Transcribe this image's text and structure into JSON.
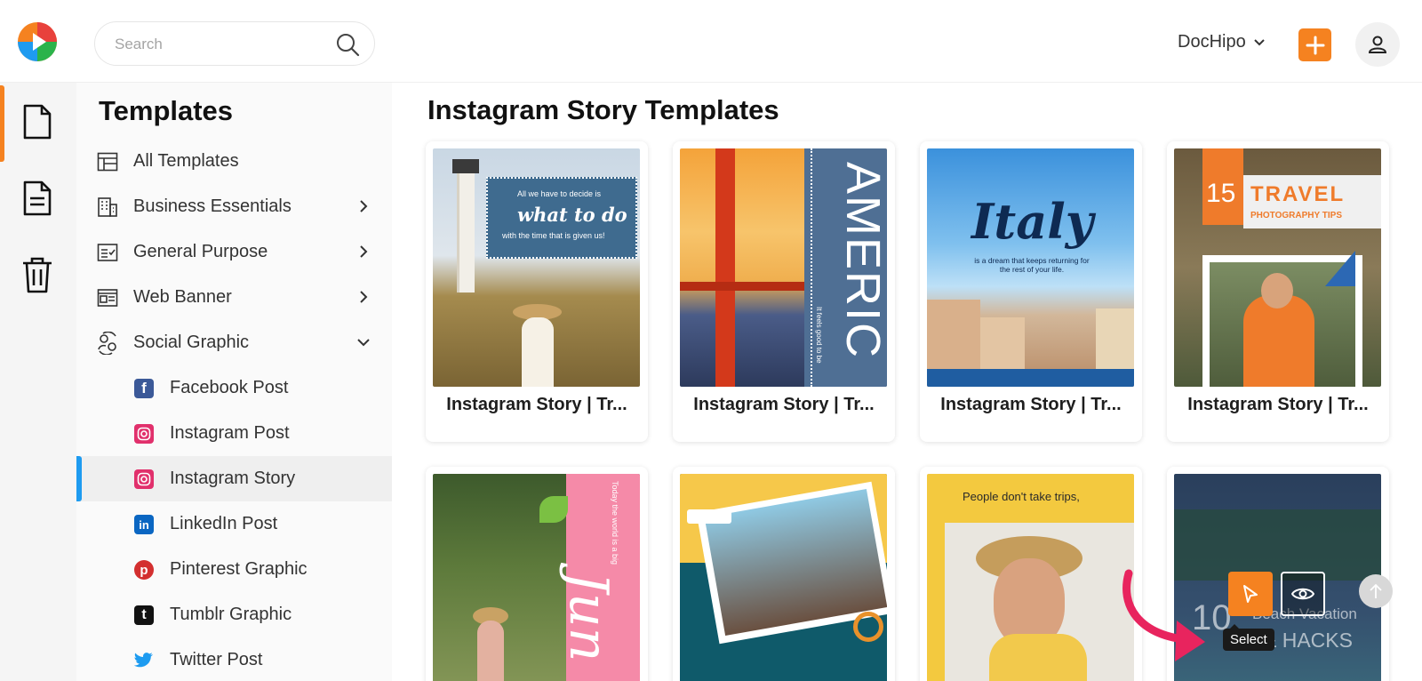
{
  "header": {
    "search_placeholder": "Search",
    "brand_label": "DocHipo",
    "accent_color": "#f58220"
  },
  "rail": {
    "items": [
      {
        "name": "documents",
        "icon": "document-icon",
        "active": true
      },
      {
        "name": "files",
        "icon": "file-text-icon",
        "active": false
      },
      {
        "name": "trash",
        "icon": "trash-icon",
        "active": false
      }
    ]
  },
  "sidebar": {
    "heading": "Templates",
    "items": [
      {
        "label": "All Templates",
        "icon": "layout-icon",
        "has_chevron": false
      },
      {
        "label": "Business Essentials",
        "icon": "building-icon",
        "has_chevron": true
      },
      {
        "label": "General Purpose",
        "icon": "checklist-icon",
        "has_chevron": true
      },
      {
        "label": "Web Banner",
        "icon": "banner-icon",
        "has_chevron": true
      },
      {
        "label": "Social Graphic",
        "icon": "social-icon",
        "has_chevron": true,
        "expanded": true
      }
    ],
    "sub_items": [
      {
        "label": "Facebook Post",
        "icon": "facebook-icon"
      },
      {
        "label": "Instagram Post",
        "icon": "instagram-icon"
      },
      {
        "label": "Instagram Story",
        "icon": "instagram-icon",
        "active": true
      },
      {
        "label": "LinkedIn Post",
        "icon": "linkedin-icon"
      },
      {
        "label": "Pinterest Graphic",
        "icon": "pinterest-icon"
      },
      {
        "label": "Tumblr Graphic",
        "icon": "tumblr-icon"
      },
      {
        "label": "Twitter Post",
        "icon": "twitter-icon"
      }
    ]
  },
  "main": {
    "title": "Instagram Story Templates",
    "cards": [
      {
        "title": "Instagram Story | Tr...",
        "thumb_text": "what to do",
        "thumb_small": "All we have to decide is",
        "thumb_small2": "with the time that is given us!"
      },
      {
        "title": "Instagram Story | Tr...",
        "thumb_text": "AMERIC",
        "thumb_small": "It feels good to be"
      },
      {
        "title": "Instagram Story | Tr...",
        "thumb_text": "Italy",
        "thumb_small": "is a dream that keeps returning for the rest of your life."
      },
      {
        "title": "Instagram Story | Tr...",
        "thumb_text": "15",
        "thumb_small": "TRAVEL",
        "thumb_small2": "PHOTOGRAPHY TIPS"
      },
      {
        "thumb_text": "Jun",
        "thumb_small": "Today the world is a big"
      },
      {},
      {
        "thumb_small": "People don't take trips,"
      },
      {
        "thumb_text": "10",
        "thumb_small": "Beach Vacation",
        "thumb_small2": "& HACKS"
      }
    ],
    "tooltip": "Select"
  }
}
